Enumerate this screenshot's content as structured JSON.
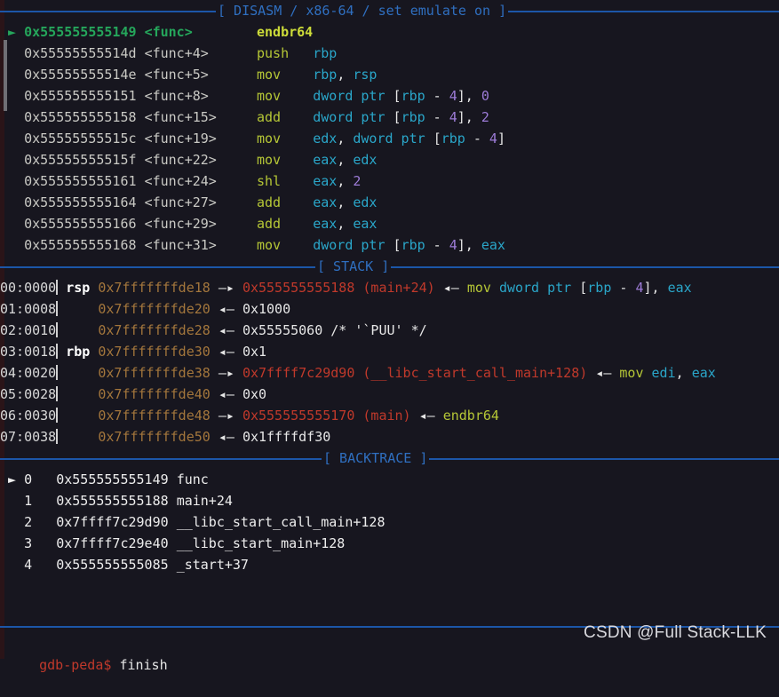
{
  "terminal": {
    "background": "#17161f",
    "prompt": "gdb-peda$",
    "command": "finish",
    "watermark": "CSDN @Full Stack-LLK"
  },
  "sections": {
    "disasm": {
      "title": "[ DISASM / x86-64 / set emulate on ]",
      "rule_color": "#1c56a8",
      "title_color": "#2f6fc0",
      "rows": [
        {
          "marker": "►",
          "current": true,
          "address": "0x555555555149",
          "symbol": "<func>",
          "mnemonic": "endbr64",
          "operands": []
        },
        {
          "marker": "",
          "current": false,
          "address": "0x55555555514d",
          "symbol": "<func+4>",
          "mnemonic": "push",
          "operands": [
            {
              "t": "reg",
              "v": "rbp"
            }
          ]
        },
        {
          "marker": "",
          "current": false,
          "address": "0x55555555514e",
          "symbol": "<func+5>",
          "mnemonic": "mov",
          "operands": [
            {
              "t": "reg",
              "v": "rbp"
            },
            {
              "t": "punct",
              "v": ", "
            },
            {
              "t": "reg",
              "v": "rsp"
            }
          ]
        },
        {
          "marker": "",
          "current": false,
          "address": "0x555555555151",
          "symbol": "<func+8>",
          "mnemonic": "mov",
          "operands": [
            {
              "t": "reg",
              "v": "dword ptr "
            },
            {
              "t": "punct",
              "v": "["
            },
            {
              "t": "reg",
              "v": "rbp"
            },
            {
              "t": "punct",
              "v": " - "
            },
            {
              "t": "num",
              "v": "4"
            },
            {
              "t": "punct",
              "v": "], "
            },
            {
              "t": "num",
              "v": "0"
            }
          ]
        },
        {
          "marker": "",
          "current": false,
          "address": "0x555555555158",
          "symbol": "<func+15>",
          "mnemonic": "add",
          "operands": [
            {
              "t": "reg",
              "v": "dword ptr "
            },
            {
              "t": "punct",
              "v": "["
            },
            {
              "t": "reg",
              "v": "rbp"
            },
            {
              "t": "punct",
              "v": " - "
            },
            {
              "t": "num",
              "v": "4"
            },
            {
              "t": "punct",
              "v": "], "
            },
            {
              "t": "num",
              "v": "2"
            }
          ]
        },
        {
          "marker": "",
          "current": false,
          "address": "0x55555555515c",
          "symbol": "<func+19>",
          "mnemonic": "mov",
          "operands": [
            {
              "t": "reg",
              "v": "edx"
            },
            {
              "t": "punct",
              "v": ", "
            },
            {
              "t": "reg",
              "v": "dword ptr "
            },
            {
              "t": "punct",
              "v": "["
            },
            {
              "t": "reg",
              "v": "rbp"
            },
            {
              "t": "punct",
              "v": " - "
            },
            {
              "t": "num",
              "v": "4"
            },
            {
              "t": "punct",
              "v": "]"
            }
          ]
        },
        {
          "marker": "",
          "current": false,
          "address": "0x55555555515f",
          "symbol": "<func+22>",
          "mnemonic": "mov",
          "operands": [
            {
              "t": "reg",
              "v": "eax"
            },
            {
              "t": "punct",
              "v": ", "
            },
            {
              "t": "reg",
              "v": "edx"
            }
          ]
        },
        {
          "marker": "",
          "current": false,
          "address": "0x555555555161",
          "symbol": "<func+24>",
          "mnemonic": "shl",
          "operands": [
            {
              "t": "reg",
              "v": "eax"
            },
            {
              "t": "punct",
              "v": ", "
            },
            {
              "t": "num",
              "v": "2"
            }
          ]
        },
        {
          "marker": "",
          "current": false,
          "address": "0x555555555164",
          "symbol": "<func+27>",
          "mnemonic": "add",
          "operands": [
            {
              "t": "reg",
              "v": "eax"
            },
            {
              "t": "punct",
              "v": ", "
            },
            {
              "t": "reg",
              "v": "edx"
            }
          ]
        },
        {
          "marker": "",
          "current": false,
          "address": "0x555555555166",
          "symbol": "<func+29>",
          "mnemonic": "add",
          "operands": [
            {
              "t": "reg",
              "v": "eax"
            },
            {
              "t": "punct",
              "v": ", "
            },
            {
              "t": "reg",
              "v": "eax"
            }
          ]
        },
        {
          "marker": "",
          "current": false,
          "address": "0x555555555168",
          "symbol": "<func+31>",
          "mnemonic": "mov",
          "operands": [
            {
              "t": "reg",
              "v": "dword ptr "
            },
            {
              "t": "punct",
              "v": "["
            },
            {
              "t": "reg",
              "v": "rbp"
            },
            {
              "t": "punct",
              "v": " - "
            },
            {
              "t": "num",
              "v": "4"
            },
            {
              "t": "punct",
              "v": "], "
            },
            {
              "t": "reg",
              "v": "eax"
            }
          ]
        }
      ]
    },
    "stack": {
      "title": "[ STACK ]",
      "rows": [
        {
          "index": "00:0000",
          "reg": "rsp",
          "address": "0x7fffffffde18",
          "arrow": "—▸",
          "parts": [
            {
              "t": "code",
              "v": "0x555555555188"
            },
            {
              "t": "punct",
              "v": " "
            },
            {
              "t": "symred",
              "v": "(main+24)"
            },
            {
              "t": "punct",
              "v": " "
            },
            {
              "t": "arrow",
              "v": "◂—"
            },
            {
              "t": "punct",
              "v": " "
            },
            {
              "t": "mnem",
              "v": "mov"
            },
            {
              "t": "punct",
              "v": " "
            },
            {
              "t": "reg",
              "v": "dword ptr "
            },
            {
              "t": "punct",
              "v": "["
            },
            {
              "t": "reg",
              "v": "rbp"
            },
            {
              "t": "punct",
              "v": " - "
            },
            {
              "t": "num",
              "v": "4"
            },
            {
              "t": "punct",
              "v": "], "
            },
            {
              "t": "reg",
              "v": "eax"
            }
          ]
        },
        {
          "index": "01:0008",
          "reg": "",
          "address": "0x7fffffffde20",
          "arrow": "◂—",
          "parts": [
            {
              "t": "white",
              "v": "0x1000"
            }
          ]
        },
        {
          "index": "02:0010",
          "reg": "",
          "address": "0x7fffffffde28",
          "arrow": "◂—",
          "parts": [
            {
              "t": "white",
              "v": "0x55555060 /* '`PUU' */"
            }
          ]
        },
        {
          "index": "03:0018",
          "reg": "rbp",
          "address": "0x7fffffffde30",
          "arrow": "◂—",
          "parts": [
            {
              "t": "white",
              "v": "0x1"
            }
          ]
        },
        {
          "index": "04:0020",
          "reg": "",
          "address": "0x7fffffffde38",
          "arrow": "—▸",
          "parts": [
            {
              "t": "code",
              "v": "0x7ffff7c29d90"
            },
            {
              "t": "punct",
              "v": " "
            },
            {
              "t": "symred",
              "v": "(__libc_start_call_main+128)"
            },
            {
              "t": "punct",
              "v": " "
            },
            {
              "t": "arrow",
              "v": "◂—"
            },
            {
              "t": "punct",
              "v": " "
            },
            {
              "t": "mnem",
              "v": "mov"
            },
            {
              "t": "punct",
              "v": " "
            },
            {
              "t": "reg",
              "v": "edi"
            },
            {
              "t": "punct",
              "v": ", "
            },
            {
              "t": "reg",
              "v": "eax"
            }
          ]
        },
        {
          "index": "05:0028",
          "reg": "",
          "address": "0x7fffffffde40",
          "arrow": "◂—",
          "parts": [
            {
              "t": "white",
              "v": "0x0"
            }
          ]
        },
        {
          "index": "06:0030",
          "reg": "",
          "address": "0x7fffffffde48",
          "arrow": "—▸",
          "parts": [
            {
              "t": "code",
              "v": "0x555555555170"
            },
            {
              "t": "punct",
              "v": " "
            },
            {
              "t": "symred",
              "v": "(main)"
            },
            {
              "t": "punct",
              "v": " "
            },
            {
              "t": "arrow",
              "v": "◂—"
            },
            {
              "t": "punct",
              "v": " "
            },
            {
              "t": "mnem",
              "v": "endbr64"
            }
          ]
        },
        {
          "index": "07:0038",
          "reg": "",
          "address": "0x7fffffffde50",
          "arrow": "◂—",
          "parts": [
            {
              "t": "white",
              "v": "0x1ffffdf30"
            }
          ]
        }
      ]
    },
    "backtrace": {
      "title": "[ BACKTRACE ]",
      "rows": [
        {
          "marker": "►",
          "index": "0",
          "address": "0x555555555149",
          "symbol": "func"
        },
        {
          "marker": "",
          "index": "1",
          "address": "0x555555555188",
          "symbol": "main+24"
        },
        {
          "marker": "",
          "index": "2",
          "address": "0x7ffff7c29d90",
          "symbol": "__libc_start_call_main+128"
        },
        {
          "marker": "",
          "index": "3",
          "address": "0x7ffff7c29e40",
          "symbol": "__libc_start_main+128"
        },
        {
          "marker": "",
          "index": "4",
          "address": "0x555555555085",
          "symbol": "_start+37"
        }
      ]
    }
  }
}
